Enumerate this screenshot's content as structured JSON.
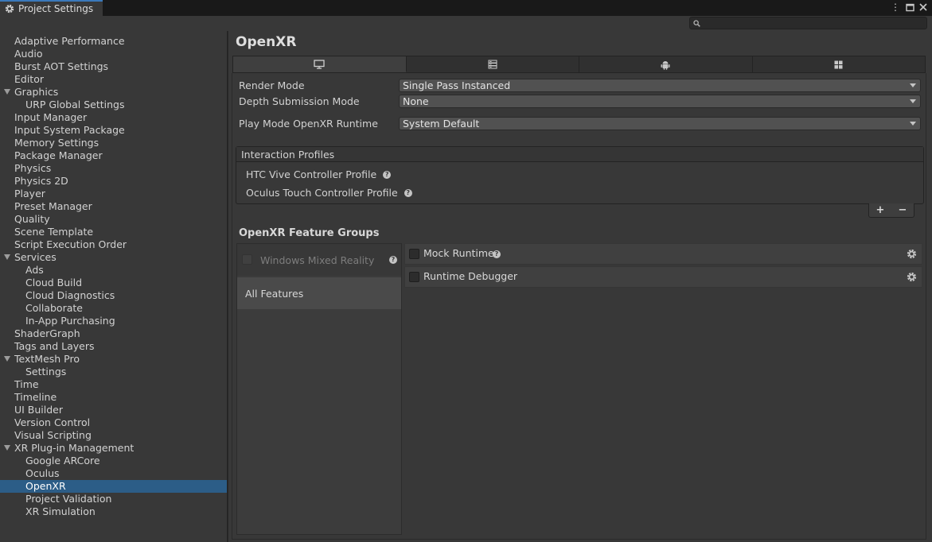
{
  "window": {
    "tab_title": "Project Settings",
    "search": {
      "value": "",
      "placeholder": ""
    }
  },
  "sidebar": {
    "items": [
      {
        "label": "Adaptive Performance",
        "indent": 0
      },
      {
        "label": "Audio",
        "indent": 0
      },
      {
        "label": "Burst AOT Settings",
        "indent": 0
      },
      {
        "label": "Editor",
        "indent": 0
      },
      {
        "label": "Graphics",
        "indent": 0,
        "expanded": true
      },
      {
        "label": "URP Global Settings",
        "indent": 1
      },
      {
        "label": "Input Manager",
        "indent": 0
      },
      {
        "label": "Input System Package",
        "indent": 0
      },
      {
        "label": "Memory Settings",
        "indent": 0
      },
      {
        "label": "Package Manager",
        "indent": 0
      },
      {
        "label": "Physics",
        "indent": 0
      },
      {
        "label": "Physics 2D",
        "indent": 0
      },
      {
        "label": "Player",
        "indent": 0
      },
      {
        "label": "Preset Manager",
        "indent": 0
      },
      {
        "label": "Quality",
        "indent": 0
      },
      {
        "label": "Scene Template",
        "indent": 0
      },
      {
        "label": "Script Execution Order",
        "indent": 0
      },
      {
        "label": "Services",
        "indent": 0,
        "expanded": true
      },
      {
        "label": "Ads",
        "indent": 1
      },
      {
        "label": "Cloud Build",
        "indent": 1
      },
      {
        "label": "Cloud Diagnostics",
        "indent": 1
      },
      {
        "label": "Collaborate",
        "indent": 1
      },
      {
        "label": "In-App Purchasing",
        "indent": 1
      },
      {
        "label": "ShaderGraph",
        "indent": 0
      },
      {
        "label": "Tags and Layers",
        "indent": 0
      },
      {
        "label": "TextMesh Pro",
        "indent": 0,
        "expanded": true
      },
      {
        "label": "Settings",
        "indent": 1
      },
      {
        "label": "Time",
        "indent": 0
      },
      {
        "label": "Timeline",
        "indent": 0
      },
      {
        "label": "UI Builder",
        "indent": 0
      },
      {
        "label": "Version Control",
        "indent": 0
      },
      {
        "label": "Visual Scripting",
        "indent": 0
      },
      {
        "label": "XR Plug-in Management",
        "indent": 0,
        "expanded": true
      },
      {
        "label": "Google ARCore",
        "indent": 1
      },
      {
        "label": "Oculus",
        "indent": 1
      },
      {
        "label": "OpenXR",
        "indent": 1,
        "selected": true
      },
      {
        "label": "Project Validation",
        "indent": 1
      },
      {
        "label": "XR Simulation",
        "indent": 1
      }
    ]
  },
  "main": {
    "title": "OpenXR",
    "platform_tabs": [
      {
        "icon": "desktop-icon",
        "active": true
      },
      {
        "icon": "server-icon",
        "active": false
      },
      {
        "icon": "android-icon",
        "active": false
      },
      {
        "icon": "windows-icon",
        "active": false
      }
    ],
    "render_mode": {
      "label": "Render Mode",
      "value": "Single Pass Instanced"
    },
    "depth_submission": {
      "label": "Depth Submission Mode",
      "value": "None"
    },
    "play_mode_runtime": {
      "label": "Play Mode OpenXR Runtime",
      "value": "System Default"
    },
    "interaction_profiles": {
      "header": "Interaction Profiles",
      "items": [
        "HTC Vive Controller Profile",
        "Oculus Touch Controller Profile"
      ],
      "add_label": "+",
      "remove_label": "−"
    },
    "feature_groups": {
      "title": "OpenXR Feature Groups",
      "groups": [
        {
          "label": "Windows Mixed Reality",
          "enabled": false
        },
        {
          "label": "All Features",
          "selected": true
        }
      ],
      "features": [
        {
          "label": "Mock Runtime",
          "checked": false,
          "help": true
        },
        {
          "label": "Runtime Debugger",
          "checked": false,
          "help": false
        }
      ]
    }
  },
  "colors": {
    "selection": "#2c5d87",
    "panel": "#383838",
    "tabbar": "#191919",
    "tab_accent": "#3a79bb"
  }
}
